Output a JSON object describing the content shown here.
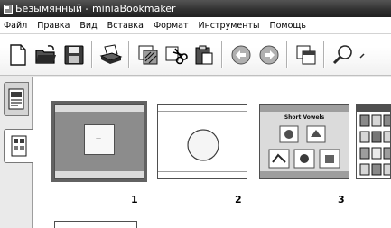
{
  "window": {
    "title": "Безымянный - miniaBookmaker"
  },
  "menu": {
    "items": [
      {
        "label": "Файл"
      },
      {
        "label": "Правка"
      },
      {
        "label": "Вид"
      },
      {
        "label": "Вставка"
      },
      {
        "label": "Формат"
      },
      {
        "label": "Инструменты"
      },
      {
        "label": "Помощь"
      }
    ]
  },
  "toolbar": {
    "buttons": [
      {
        "icon": "new-document-icon"
      },
      {
        "icon": "open-folder-icon"
      },
      {
        "icon": "save-floppy-icon"
      },
      {
        "icon": "print-icon"
      },
      {
        "icon": "slide-layout-icon"
      },
      {
        "icon": "cut-icon"
      },
      {
        "icon": "paste-icon"
      },
      {
        "icon": "undo-icon"
      },
      {
        "icon": "redo-icon"
      },
      {
        "icon": "copy-page-icon"
      },
      {
        "icon": "zoom-icon"
      }
    ]
  },
  "slides": [
    {
      "number": "1",
      "caption": "—"
    },
    {
      "number": "2"
    },
    {
      "number": "3",
      "title": "Short Vowels"
    }
  ]
}
